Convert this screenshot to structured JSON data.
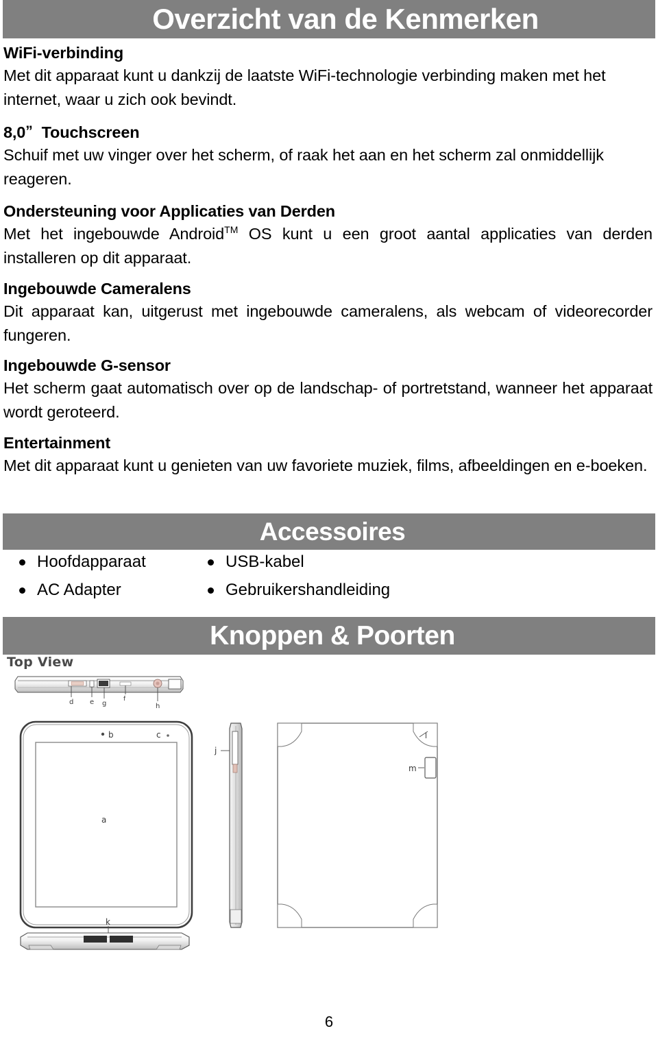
{
  "document": {
    "page_number": "6",
    "banner_color": "#808080",
    "banner_text_color": "#ffffff"
  },
  "banners": {
    "features": "Overzicht van de Kenmerken",
    "accessories": "Accessoires",
    "buttons_ports": "Knoppen & Poorten"
  },
  "features": [
    {
      "heading": "WiFi-verbinding",
      "body": "Met dit apparaat kunt u dankzij de laatste WiFi-technologie verbinding maken met het internet, waar u zich ook bevindt."
    },
    {
      "heading_size": "8,0",
      "heading_inch_mark": "”",
      "heading": "Touchscreen",
      "body": "Schuif met uw vinger over het scherm, of raak het aan en het scherm zal onmiddellijk reageren."
    },
    {
      "heading": "Ondersteuning voor Applicaties van Derden",
      "body_part1": "Met het ingebouwde Android",
      "body_superscript": "TM",
      "body_part2": " OS kunt u een groot aantal applicaties van derden installeren op dit apparaat."
    },
    {
      "heading": "Ingebouwde Cameralens",
      "body": "Dit apparaat kan, uitgerust met ingebouwde cameralens, als webcam of videorecorder fungeren."
    },
    {
      "heading": "Ingebouwde G-sensor",
      "body": "Het scherm gaat automatisch over op de landschap- of portretstand, wanneer het apparaat wordt geroteerd."
    },
    {
      "heading": "Entertainment",
      "body": "Met dit apparaat kunt u genieten van uw favoriete muziek, films, afbeeldingen en e-boeken."
    }
  ],
  "accessories": {
    "rows": [
      {
        "left": "Hoofdapparaat",
        "right": "USB-kabel"
      },
      {
        "left": "AC Adapter",
        "right": "Gebruikershandleiding"
      }
    ]
  },
  "diagram": {
    "top_view_label": "Top View",
    "callouts": {
      "front_screen": "a",
      "front_sensor": "b",
      "front_camera": "c",
      "top_d": "d",
      "top_e": "e",
      "top_f": "f",
      "top_g": "g",
      "top_h": "h",
      "side_j": "j",
      "bottom_k": "k",
      "back_l": "l",
      "back_m": "m"
    }
  }
}
